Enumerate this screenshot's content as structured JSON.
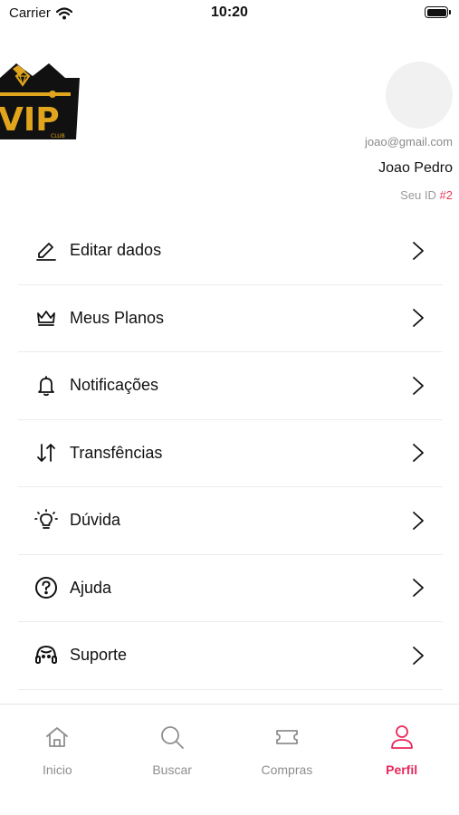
{
  "status_bar": {
    "carrier": "Carrier",
    "time": "10:20"
  },
  "header": {
    "logo_text": "VIP",
    "logo_subtext": "CLUB",
    "email": "joao@gmail.com",
    "name": "Joao Pedro",
    "id_label": "Seu ID",
    "id_value": "#2"
  },
  "menu": {
    "items": [
      {
        "label": "Editar dados",
        "icon": "pencil-icon"
      },
      {
        "label": "Meus Planos",
        "icon": "crown-icon"
      },
      {
        "label": "Notificações",
        "icon": "bell-icon"
      },
      {
        "label": "Transfências",
        "icon": "arrows-transfer-icon"
      },
      {
        "label": "Dúvida",
        "icon": "lightbulb-icon"
      },
      {
        "label": "Ajuda",
        "icon": "question-circle-icon"
      },
      {
        "label": "Suporte",
        "icon": "headset-icon"
      }
    ]
  },
  "tab_bar": {
    "tabs": [
      {
        "label": "Inicio",
        "icon": "home-icon",
        "active": false
      },
      {
        "label": "Buscar",
        "icon": "search-icon",
        "active": false
      },
      {
        "label": "Compras",
        "icon": "ticket-icon",
        "active": false
      },
      {
        "label": "Perfil",
        "icon": "user-icon",
        "active": true
      }
    ],
    "active_color": "#e8285a",
    "inactive_color": "#8e8e8e"
  },
  "colors": {
    "accent": "#e8285a",
    "id_value": "#e83a5a",
    "logo_gold": "#e0a51c",
    "logo_dark": "#111111"
  }
}
